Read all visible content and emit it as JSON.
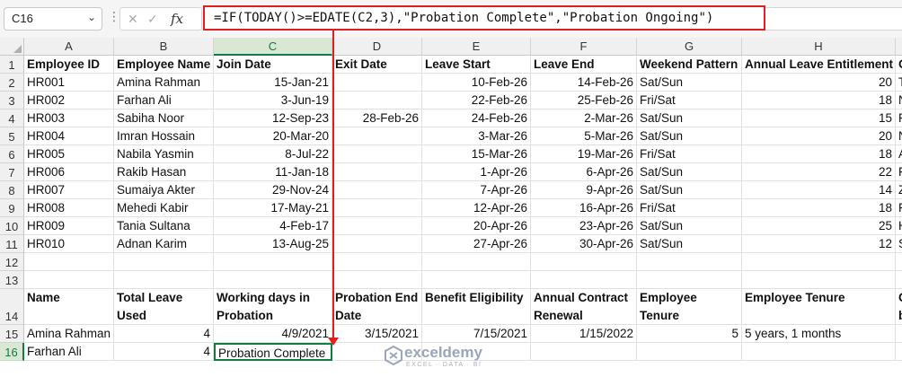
{
  "name_box": {
    "value": "C16"
  },
  "formula_bar": {
    "fx_label": "fx",
    "cancel_glyph": "✕",
    "confirm_glyph": "✓",
    "formula": "=IF(TODAY()>=EDATE(C2,3),\"Probation Complete\",\"Probation Ongoing\")"
  },
  "columns": [
    "A",
    "B",
    "C",
    "D",
    "E",
    "F",
    "G",
    "H",
    "I"
  ],
  "rows": [
    "1",
    "2",
    "3",
    "4",
    "5",
    "6",
    "7",
    "8",
    "9",
    "10",
    "11",
    "12",
    "13",
    "14",
    "15",
    "16"
  ],
  "active_cell": {
    "column": "C",
    "row": "16"
  },
  "cells": {
    "r1": [
      "Employee ID",
      "Employee Name",
      "Join Date",
      "Exit Date",
      "Leave Start",
      "Leave End",
      "Weekend Pattern",
      "Annual Leave Entitlement",
      "O"
    ],
    "r2": [
      "HR001",
      "Amina Rahman",
      "15-Jan-21",
      "",
      "10-Feb-26",
      "14-Feb-26",
      "Sat/Sun",
      "20",
      "T"
    ],
    "r3": [
      "HR002",
      "Farhan Ali",
      "3-Jun-19",
      "",
      "22-Feb-26",
      "25-Feb-26",
      "Fri/Sat",
      "18",
      "N"
    ],
    "r4": [
      "HR003",
      "Sabiha Noor",
      "12-Sep-23",
      "28-Feb-26",
      "24-Feb-26",
      "2-Mar-26",
      "Sat/Sun",
      "15",
      "F"
    ],
    "r5": [
      "HR004",
      "Imran Hossain",
      "20-Mar-20",
      "",
      "3-Mar-26",
      "5-Mar-26",
      "Sat/Sun",
      "20",
      "N"
    ],
    "r6": [
      "HR005",
      "Nabila Yasmin",
      "8-Jul-22",
      "",
      "15-Mar-26",
      "19-Mar-26",
      "Fri/Sat",
      "18",
      "A"
    ],
    "r7": [
      "HR006",
      "Rakib Hasan",
      "11-Jan-18",
      "",
      "1-Apr-26",
      "6-Apr-26",
      "Sat/Sun",
      "22",
      "F"
    ],
    "r8": [
      "HR007",
      "Sumaiya Akter",
      "29-Nov-24",
      "",
      "7-Apr-26",
      "9-Apr-26",
      "Sat/Sun",
      "14",
      "Z"
    ],
    "r9": [
      "HR008",
      "Mehedi Kabir",
      "17-May-21",
      "",
      "12-Apr-26",
      "16-Apr-26",
      "Fri/Sat",
      "18",
      "F"
    ],
    "r10": [
      "HR009",
      "Tania Sultana",
      "4-Feb-17",
      "",
      "20-Apr-26",
      "23-Apr-26",
      "Sat/Sun",
      "25",
      "H"
    ],
    "r11": [
      "HR010",
      "Adnan Karim",
      "13-Aug-25",
      "",
      "27-Apr-26",
      "30-Apr-26",
      "Sat/Sun",
      "12",
      "S"
    ],
    "r14": [
      "Name",
      "Total Leave Used",
      "Working days in Probation",
      "Probation End Date",
      "Benefit Eligibility",
      "Annual Contract Renewal",
      "Employee Tenure",
      "Employee Tenure",
      "C b"
    ],
    "r15": [
      "Amina Rahman",
      "4",
      "4/9/2021",
      "3/15/2021",
      "7/15/2021",
      "1/15/2022",
      "5",
      "5 years, 1 months",
      ""
    ],
    "r16": [
      "Farhan Ali",
      "4",
      "Probation Complete",
      "",
      "",
      "",
      "",
      "",
      ""
    ]
  },
  "watermark": {
    "name": "exceldemy",
    "tagline": "EXCEL · DATA · BI"
  },
  "colors": {
    "accent_green": "#107c41",
    "highlight_red": "#e02020"
  }
}
